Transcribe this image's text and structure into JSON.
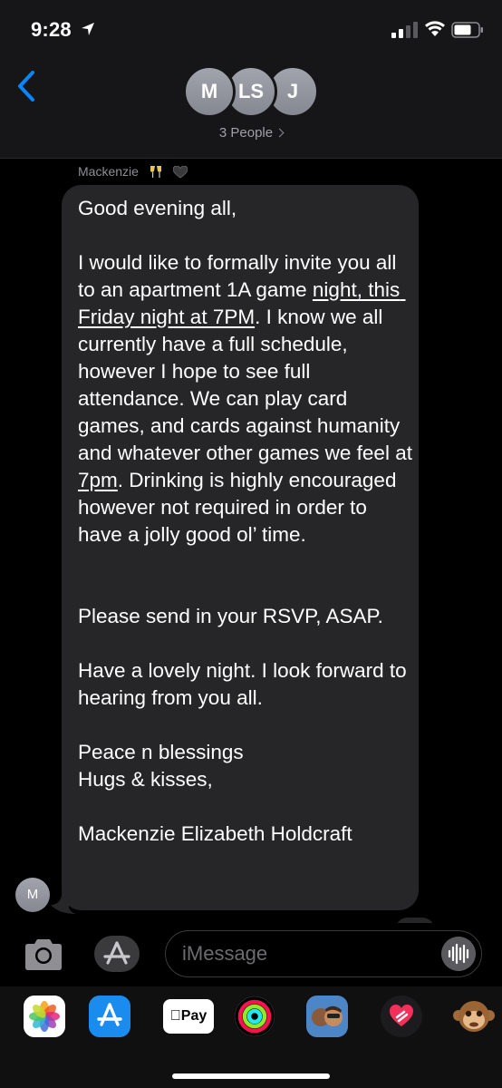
{
  "status_bar": {
    "time": "9:28"
  },
  "header": {
    "avatars": [
      "M",
      "LS",
      "J"
    ],
    "people_label": "3 People"
  },
  "message": {
    "sender": "Mackenzie",
    "sender_avatar": "M",
    "paragraphs": {
      "p1": "Good evening all,",
      "p2a": "I would like to formally invite you all to an apartment 1A game ",
      "p2_link1": "night, this Friday night at 7PM",
      "p2b": ". I know we all currently have a full schedule, however I hope to see full attendance. We can play card games, and cards against humanity and whatever other games we feel at ",
      "p2_link2": "7pm",
      "p2c": ". Drinking is highly encouraged however not required in order to have a jolly good ol’ time.",
      "p3": "Please send in your RSVP, ASAP.",
      "p4": "Have a lovely night. I look forward to hearing from you all.",
      "p5": "Peace n blessings",
      "p6": "Hugs & kisses,",
      "p7": "Mackenzie Elizabeth Holdcraft"
    }
  },
  "composer": {
    "placeholder": "iMessage"
  },
  "drawer": {
    "apple_pay_label": "Pay"
  },
  "icons": {
    "back": "chevron-left-icon",
    "camera": "camera-icon",
    "apps": "app-store-icon",
    "audio": "waveform-icon"
  },
  "colors": {
    "accent": "#0a84ff",
    "bubble": "#262628",
    "header_bg": "#161618",
    "avatar": "#9a9da5"
  }
}
